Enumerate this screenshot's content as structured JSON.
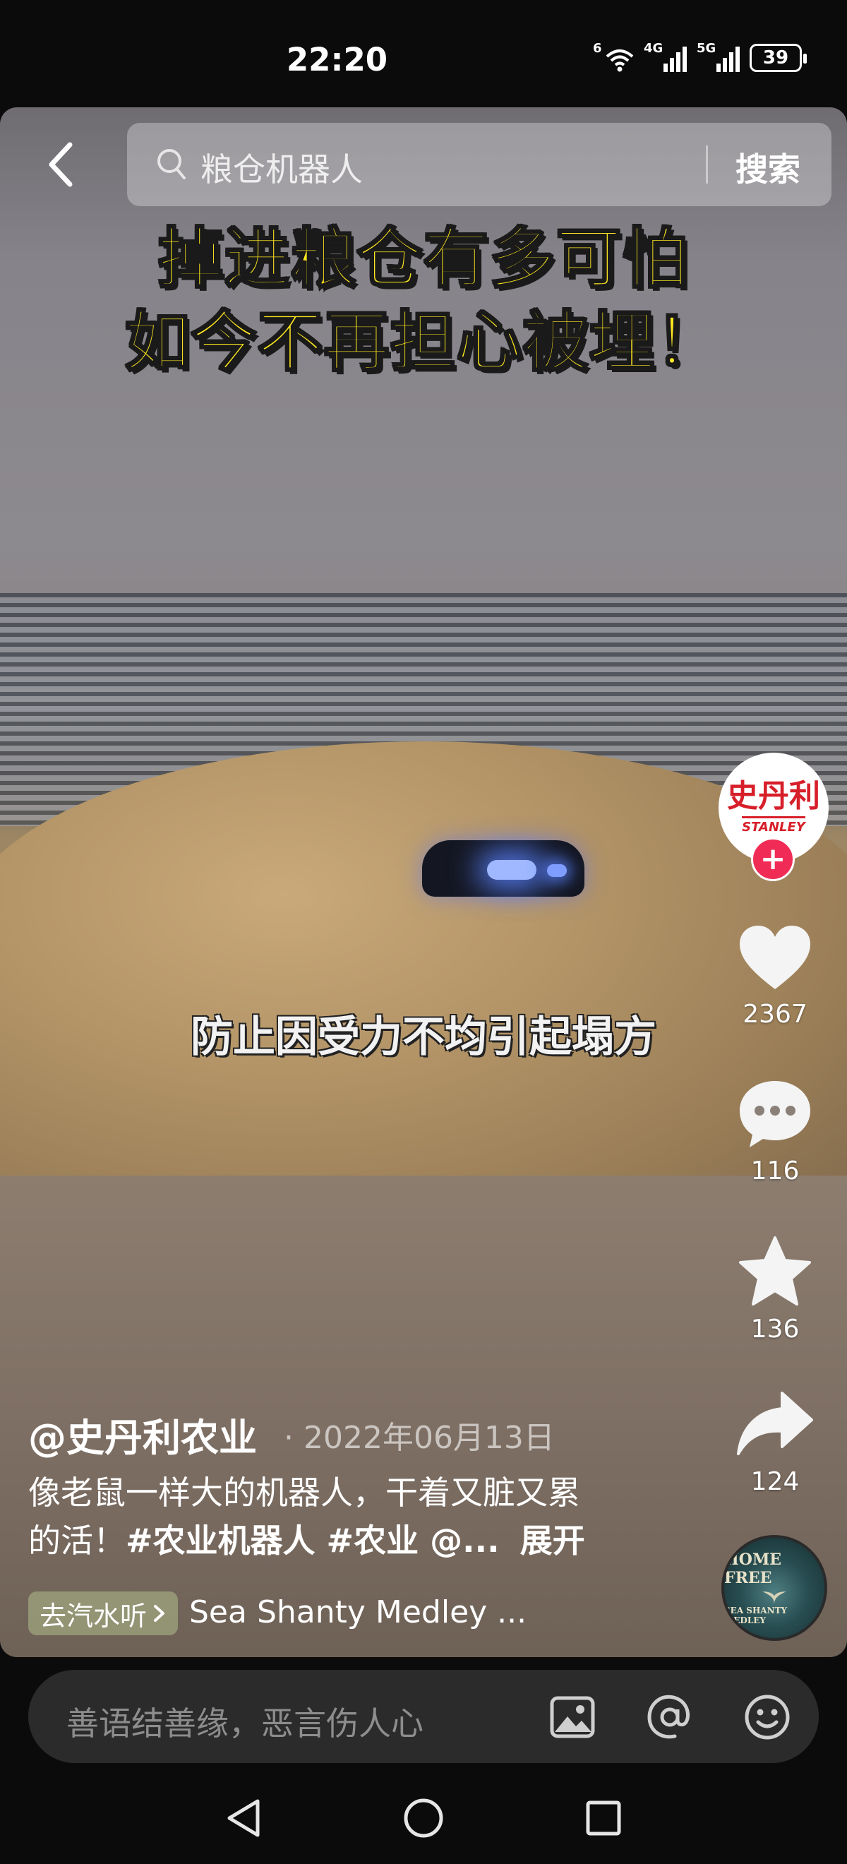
{
  "status_bar": {
    "time": "22:20",
    "wifi_label": "6",
    "signal1_label": "4G",
    "signal2_label": "5G",
    "battery": "39"
  },
  "search": {
    "query": "粮仓机器人",
    "button_label": "搜索"
  },
  "video": {
    "title_line1": "掉进粮仓有多可怕",
    "title_line2": "如今不再担心被埋！",
    "subtitle": "防止因受力不均引起塌方",
    "title_color": "#ffe81f"
  },
  "avatar": {
    "brand_cn": "史丹利",
    "brand_en": "STANLEY",
    "follow_label": "+"
  },
  "actions": {
    "likes": "2367",
    "comments": "116",
    "favorites": "136",
    "shares": "124"
  },
  "post": {
    "author": "@史丹利农业",
    "date": "· 2022年06月13日",
    "text_line1": "像老鼠一样大的机器人，干着又脏又累",
    "text_line2_plain": "的活！",
    "hashtags": "#农业机器人 #农业 @...",
    "expand_label": "展开"
  },
  "music": {
    "tag_label": "去汽水听",
    "title": "Sea Shanty Medley ...",
    "disc_top": "HOME FREE",
    "disc_bottom": "SEA SHANTY MEDLEY"
  },
  "comment_bar": {
    "placeholder": "善语结善缘，恶言伤人心"
  },
  "colors": {
    "accent_red": "#f02c56",
    "brand_red": "#d71f2a",
    "background": "#0b0b0b"
  }
}
